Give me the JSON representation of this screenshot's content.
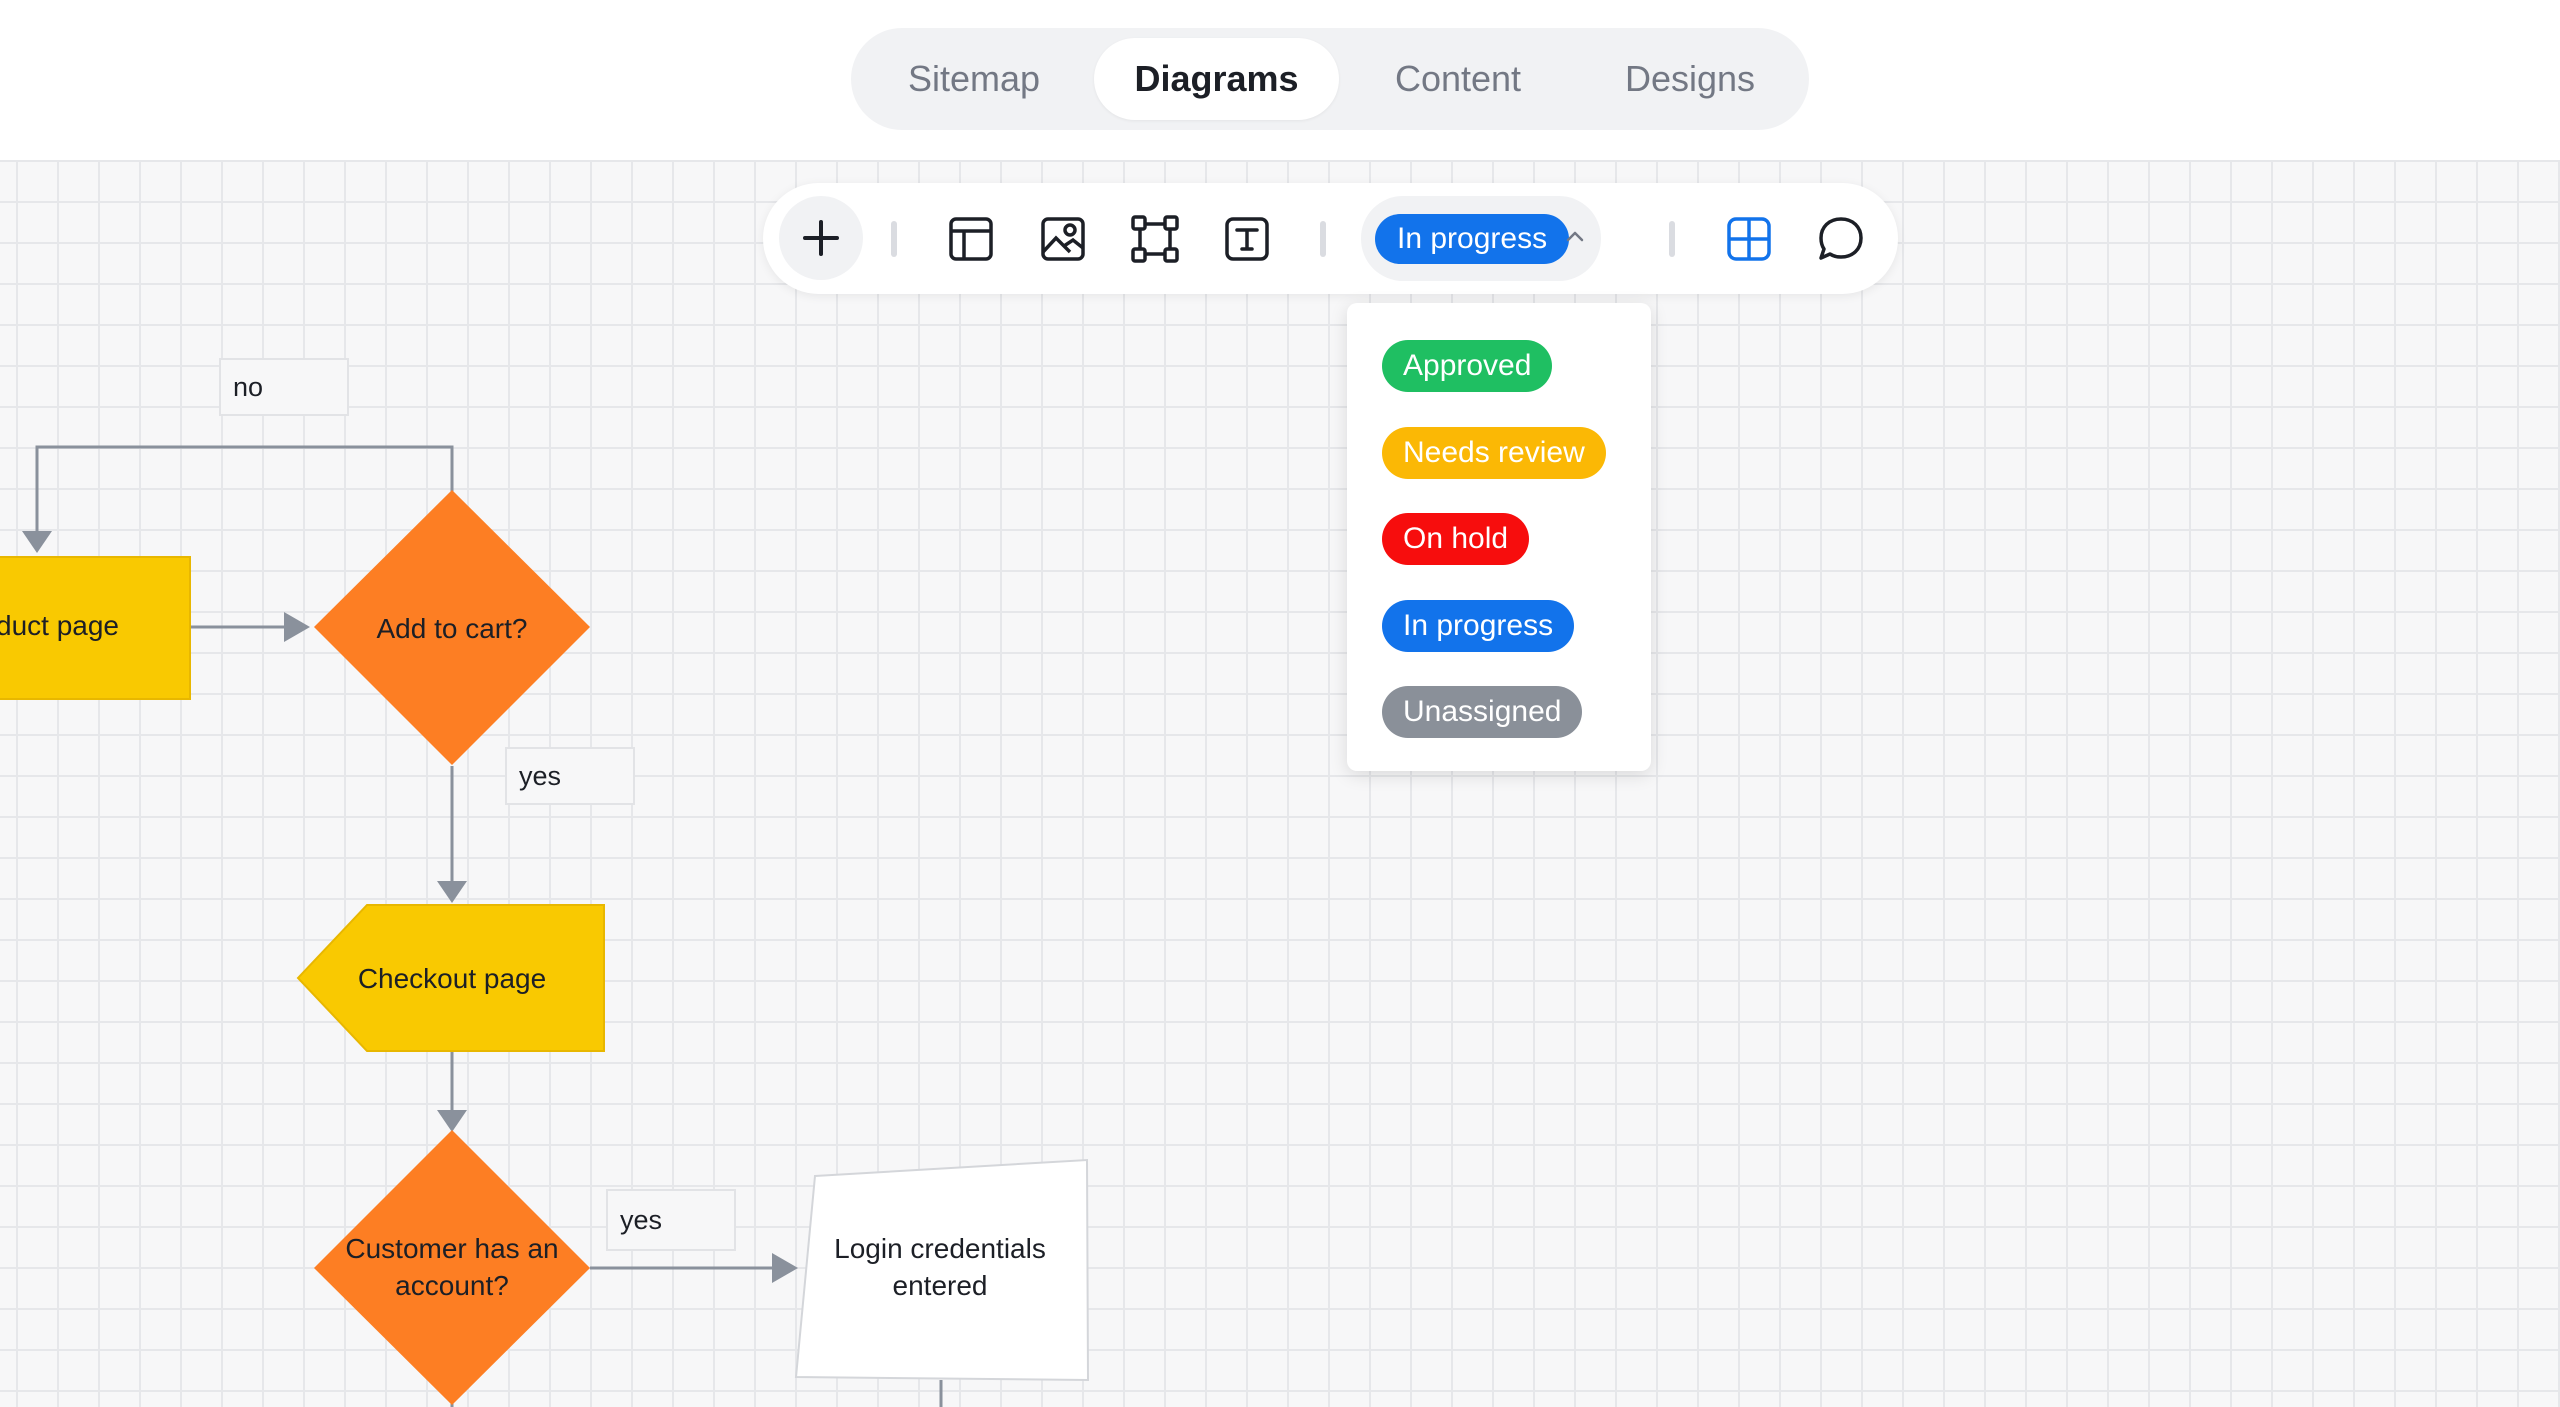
{
  "tabs": [
    {
      "label": "Sitemap",
      "active": false
    },
    {
      "label": "Diagrams",
      "active": true
    },
    {
      "label": "Content",
      "active": false
    },
    {
      "label": "Designs",
      "active": false
    }
  ],
  "toolbar": {
    "icons": [
      "plus-icon",
      "layout-icon",
      "image-icon",
      "frame-icon",
      "text-icon",
      "grid-icon",
      "comment-icon"
    ],
    "status": {
      "label": "In progress",
      "color": "#1273eb"
    }
  },
  "status_menu": {
    "options": [
      {
        "label": "Approved",
        "color": "#1fbf62"
      },
      {
        "label": "Needs review",
        "color": "#fbb805"
      },
      {
        "label": "On hold",
        "color": "#f70d0d"
      },
      {
        "label": "In progress",
        "color": "#1273eb"
      },
      {
        "label": "Unassigned",
        "color": "#8a9099"
      }
    ]
  },
  "flowchart": {
    "edge_labels": {
      "no": "no",
      "yes_1": "yes",
      "yes_2": "yes"
    },
    "nodes": {
      "product_page": "duct page",
      "add_to_cart": "Add to cart?",
      "checkout_page": "Checkout page",
      "customer_has_account_line1": "Customer has an",
      "customer_has_account_line2": "account?",
      "login_entered_line1": "Login credentials",
      "login_entered_line2": "entered"
    },
    "colors": {
      "decision": "#fd7e23",
      "page": "#f9c901",
      "connector": "#8a919c"
    }
  }
}
